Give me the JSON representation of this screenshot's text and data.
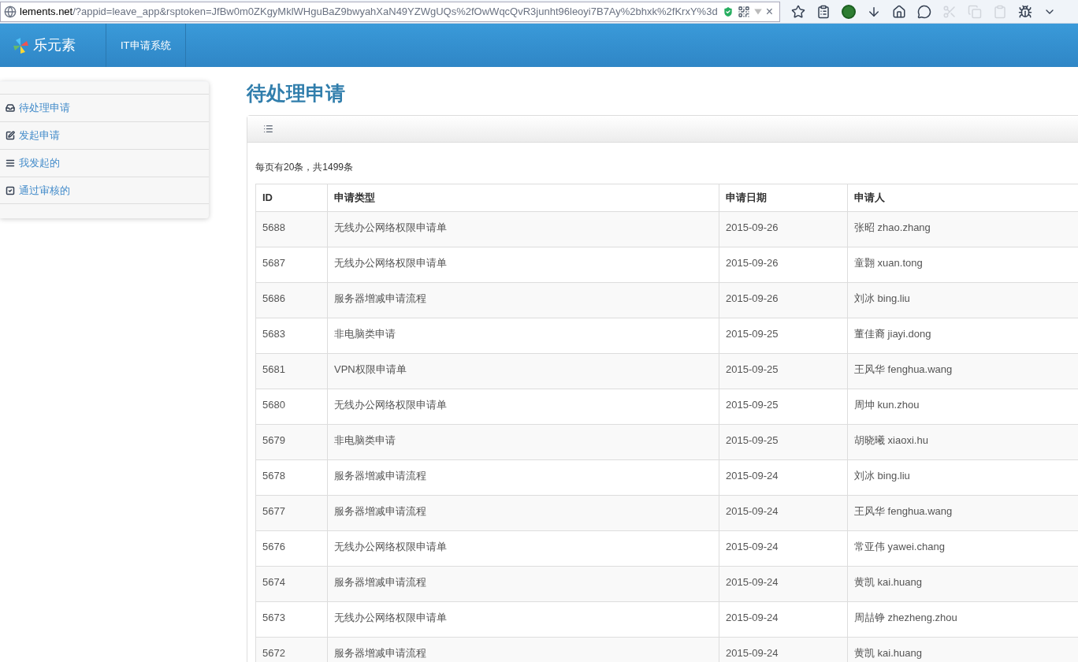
{
  "browser": {
    "url_host": "lements.net",
    "url_path": "/?appid=leave_app&rsptoken=JfBw0m0ZKgyMklWHguBaZ9bwyahXaN49YZWgUQs%2fOwWqcQvR3junht96leoyi7B7Ay%2bhxk%2fKrxY%3d",
    "close": "×"
  },
  "header": {
    "logo_text": "乐元素",
    "nav": [
      "IT申请系统"
    ]
  },
  "sidebar": {
    "items": [
      {
        "label": "待处理申请"
      },
      {
        "label": "发起申请"
      },
      {
        "label": "我发起的"
      },
      {
        "label": "通过审核的"
      }
    ]
  },
  "page_title": "待处理申请",
  "summary": "每页有20条，共1499条",
  "table": {
    "columns": [
      "ID",
      "申请类型",
      "申请日期",
      "申请人"
    ],
    "rows": [
      [
        "5688",
        "无线办公网络权限申请单",
        "2015-09-26",
        "张昭 zhao.zhang"
      ],
      [
        "5687",
        "无线办公网络权限申请单",
        "2015-09-26",
        "童翾 xuan.tong"
      ],
      [
        "5686",
        "服务器增减申请流程",
        "2015-09-26",
        "刘冰 bing.liu"
      ],
      [
        "5683",
        "非电脑类申请",
        "2015-09-25",
        "董佳裔 jiayi.dong"
      ],
      [
        "5681",
        "VPN权限申请单",
        "2015-09-25",
        "王风华 fenghua.wang"
      ],
      [
        "5680",
        "无线办公网络权限申请单",
        "2015-09-25",
        "周坤 kun.zhou"
      ],
      [
        "5679",
        "非电脑类申请",
        "2015-09-25",
        "胡晓曦 xiaoxi.hu"
      ],
      [
        "5678",
        "服务器增减申请流程",
        "2015-09-24",
        "刘冰 bing.liu"
      ],
      [
        "5677",
        "服务器增减申请流程",
        "2015-09-24",
        "王风华 fenghua.wang"
      ],
      [
        "5676",
        "无线办公网络权限申请单",
        "2015-09-24",
        "常亚伟 yawei.chang"
      ],
      [
        "5674",
        "服务器增减申请流程",
        "2015-09-24",
        "黄凯 kai.huang"
      ],
      [
        "5673",
        "无线办公网络权限申请单",
        "2015-09-24",
        "周喆铮 zhezheng.zhou"
      ],
      [
        "5672",
        "服务器增减申请流程",
        "2015-09-24",
        "黄凯 kai.huang"
      ]
    ]
  }
}
